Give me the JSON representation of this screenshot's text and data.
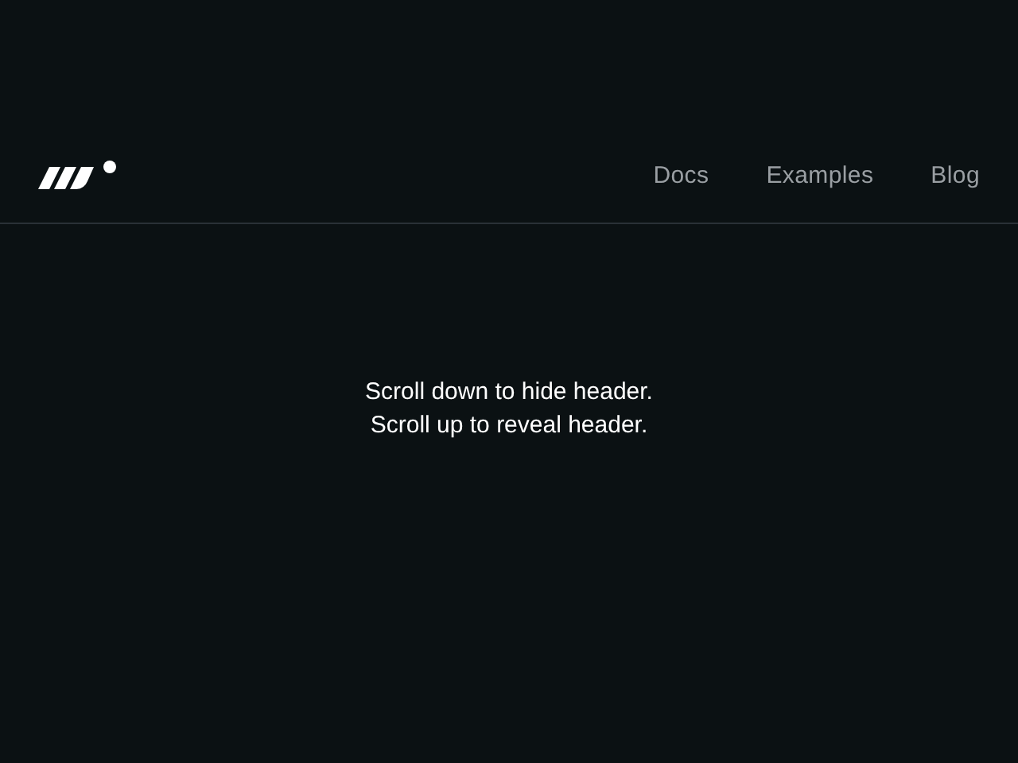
{
  "header": {
    "nav": [
      {
        "label": "Docs"
      },
      {
        "label": "Examples"
      },
      {
        "label": "Blog"
      }
    ]
  },
  "message": {
    "lines": [
      "Scroll down to hide header.",
      "Scroll up to reveal header."
    ]
  }
}
